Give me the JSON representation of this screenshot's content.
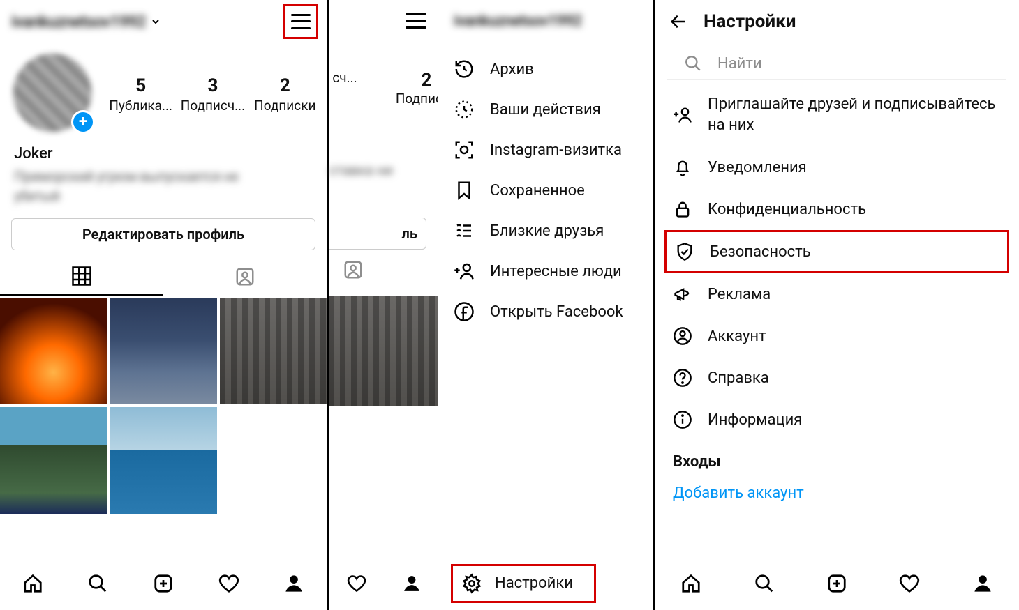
{
  "panel1": {
    "username": "ivankuznetsov1992",
    "stats": [
      {
        "num": "5",
        "label": "Публика..."
      },
      {
        "num": "3",
        "label": "Подписч..."
      },
      {
        "num": "2",
        "label": "Подписки"
      }
    ],
    "display_name": "Joker",
    "bio_line1": "Приморский угрюм выпускается не",
    "bio_line2": "убитый",
    "edit_profile": "Редактировать профиль"
  },
  "panel2": {
    "username": "ivankuznetsov1992",
    "stat_partial": {
      "num": "2",
      "label": "Подписки"
    },
    "stat_partial2_label": "сч...",
    "bio_partial": "ставка ни",
    "button_partial": "ль",
    "menu": {
      "archive": "Архив",
      "activity": "Ваши действия",
      "nametag": "Instagram-визитка",
      "saved": "Сохраненное",
      "close_friends": "Близкие друзья",
      "discover": "Интересные люди",
      "facebook": "Открыть Facebook"
    },
    "settings": "Настройки"
  },
  "panel3": {
    "title": "Настройки",
    "search_placeholder": "Найти",
    "items": {
      "invite": "Приглашайте друзей и подписывайтесь на них",
      "notifications": "Уведомления",
      "privacy": "Конфиденциальность",
      "security": "Безопасность",
      "ads": "Реклама",
      "account": "Аккаунт",
      "help": "Справка",
      "about": "Информация"
    },
    "logins_header": "Входы",
    "add_account": "Добавить аккаунт"
  }
}
